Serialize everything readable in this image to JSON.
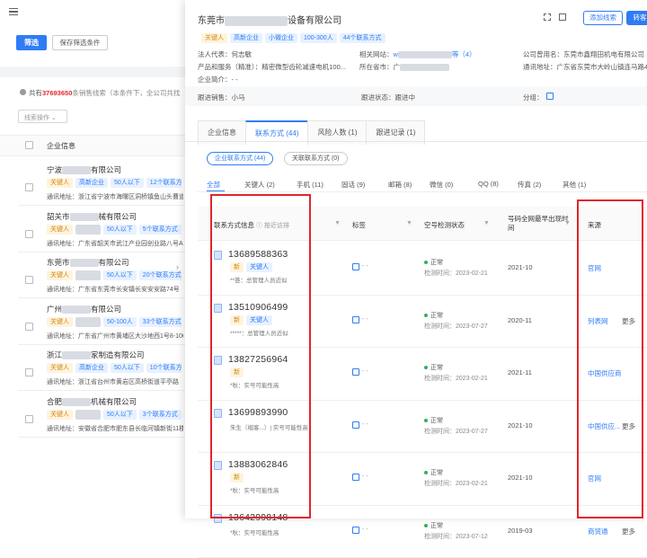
{
  "left": {
    "filter_btn": "筛选",
    "save_filter_btn": "保存筛选条件",
    "result_prefix": "共有",
    "result_count": "37693650",
    "result_suffix": "条销售线索（本条件下，全公司共找",
    "action_select": "线索操作",
    "col_header": "企业信息",
    "companies": [
      {
        "name_a": "宁波",
        "name_b": "有限公司",
        "tags": [
          "关键人",
          "高新企业",
          "50人以下",
          "12个联系方式"
        ],
        "addr": "通讯地址：浙江省宁波市海曙区洞桥镇鱼山头曹道"
      },
      {
        "name_a": "韶关市",
        "name_b": "械有限公司",
        "tags": [
          "关键人",
          "",
          "50人以下",
          "5个联系方式"
        ],
        "addr": "通讯地址：广东省韶关市武江产业园创业路八号A7厂"
      },
      {
        "name_a": "东莞市",
        "name_b": "有限公司",
        "tags": [
          "关键人",
          "",
          "50人以下",
          "20个联系方式"
        ],
        "addr": "通讯地址：广东省东莞市长安镇长安安安路74号"
      },
      {
        "name_a": "广州",
        "name_b": "有限公司",
        "tags": [
          "关键人",
          "",
          "50-100人",
          "33个联系方式"
        ],
        "addr": "通讯地址：广东省广州市黄埔区大沙地西1号8-106-02"
      },
      {
        "name_a": "浙江",
        "name_b": "家制造有限公司",
        "tags": [
          "关键人",
          "高新企业",
          "50人以下",
          "10个联系方式"
        ],
        "addr": "通讯地址：浙江省台州市黄岩区高桥街道平亭路"
      },
      {
        "name_a": "合肥",
        "name_b": "机械有限公司",
        "tags": [
          "关键人",
          "",
          "50人以下",
          "3个联系方式"
        ],
        "addr": "通讯地址：安徽省合肥市肥东县长临河镇新街11楼"
      }
    ]
  },
  "drawer": {
    "title_a": "东莞市",
    "title_b": "设备有限公司",
    "btn_add": "添加线索",
    "btn_crm": "转客",
    "tags": [
      "关键人",
      "高新企业",
      "小微企业",
      "100-300人",
      "44个联系方式"
    ],
    "legal_label": "法人代表：",
    "legal_value": "何志敏",
    "website_label": "相关网站：",
    "website_value": "w",
    "website_count": "等（4）",
    "alias_label": "公司曾用名：",
    "alias_value": "东莞市鑫翔田机电有限公司",
    "products_label": "产品和服务（精准）：",
    "products_value": "精密微型齿轮减速电机100...",
    "region_label": "所在省市：",
    "region_value": "广",
    "mail_label": "通讯地址：",
    "mail_value": "广东省东莞市大岭山镇连马路41",
    "intro_label": "企业简介：",
    "intro_value": "- -",
    "follower_label": "跟进销售：",
    "follower_value": "小马",
    "status_label": "跟进状态：",
    "status_value": "跟进中",
    "group_label": "分组：",
    "tabs": [
      "企业信息",
      "联系方式 (44)",
      "风险人数 (1)",
      "跟进记录 (1)"
    ],
    "pill_company": "企业联系方式 (44)",
    "pill_related": "关联联系方式 (0)",
    "contact_types": [
      "全部",
      "关键人 (2)",
      "手机 (11)",
      "固话 (9)",
      "邮箱 (8)",
      "微信 (0)",
      "QQ (8)",
      "传真 (2)",
      "其他 (1)"
    ],
    "headers": {
      "info": "联系方式信息",
      "info_sub": "按近访排",
      "tag": "标签",
      "status": "空号检测状态",
      "last": "号码全网最早出现时间",
      "source": "来源"
    },
    "rows": [
      {
        "phone": "13689588363",
        "tags": [
          "新",
          "关键人"
        ],
        "note": "**荟：总管理人员近似",
        "status": "正常",
        "date": "检测时间：2023-02-21",
        "first": "2021-10",
        "source": "官网",
        "more": ""
      },
      {
        "phone": "13510906499",
        "tags": [
          "新",
          "关键人"
        ],
        "note": "*****：总管理人员近似",
        "status": "正常",
        "date": "检测时间：2023-07-27",
        "first": "2020-11",
        "source": "列表网",
        "more": "更多"
      },
      {
        "phone": "13827256964",
        "tags": [
          "新"
        ],
        "note": "*秋：实号可能性高",
        "status": "正常",
        "date": "检测时间：2023-02-21",
        "first": "2021-11",
        "source": "中国供应商",
        "more": ""
      },
      {
        "phone": "13699893990",
        "tags": [],
        "note": "朱生（缩客...）| 实号可能性高",
        "status": "正常",
        "date": "检测时间：2023-07-27",
        "first": "2021-10",
        "source": "中国供应...",
        "more": "更多"
      },
      {
        "phone": "13883062846",
        "tags": [
          "新"
        ],
        "note": "*秋：实号可能性高",
        "status": "正常",
        "date": "检测时间：2023-02-21",
        "first": "2021-10",
        "source": "官网",
        "more": ""
      },
      {
        "phone": "13642998148",
        "tags": [],
        "note": "*秋：实号可能性高",
        "status": "正常",
        "date": "检测时间：2023-07-12",
        "first": "2019-03",
        "source": "商贸通",
        "more": "更多"
      }
    ],
    "edit_dash": "- -"
  }
}
